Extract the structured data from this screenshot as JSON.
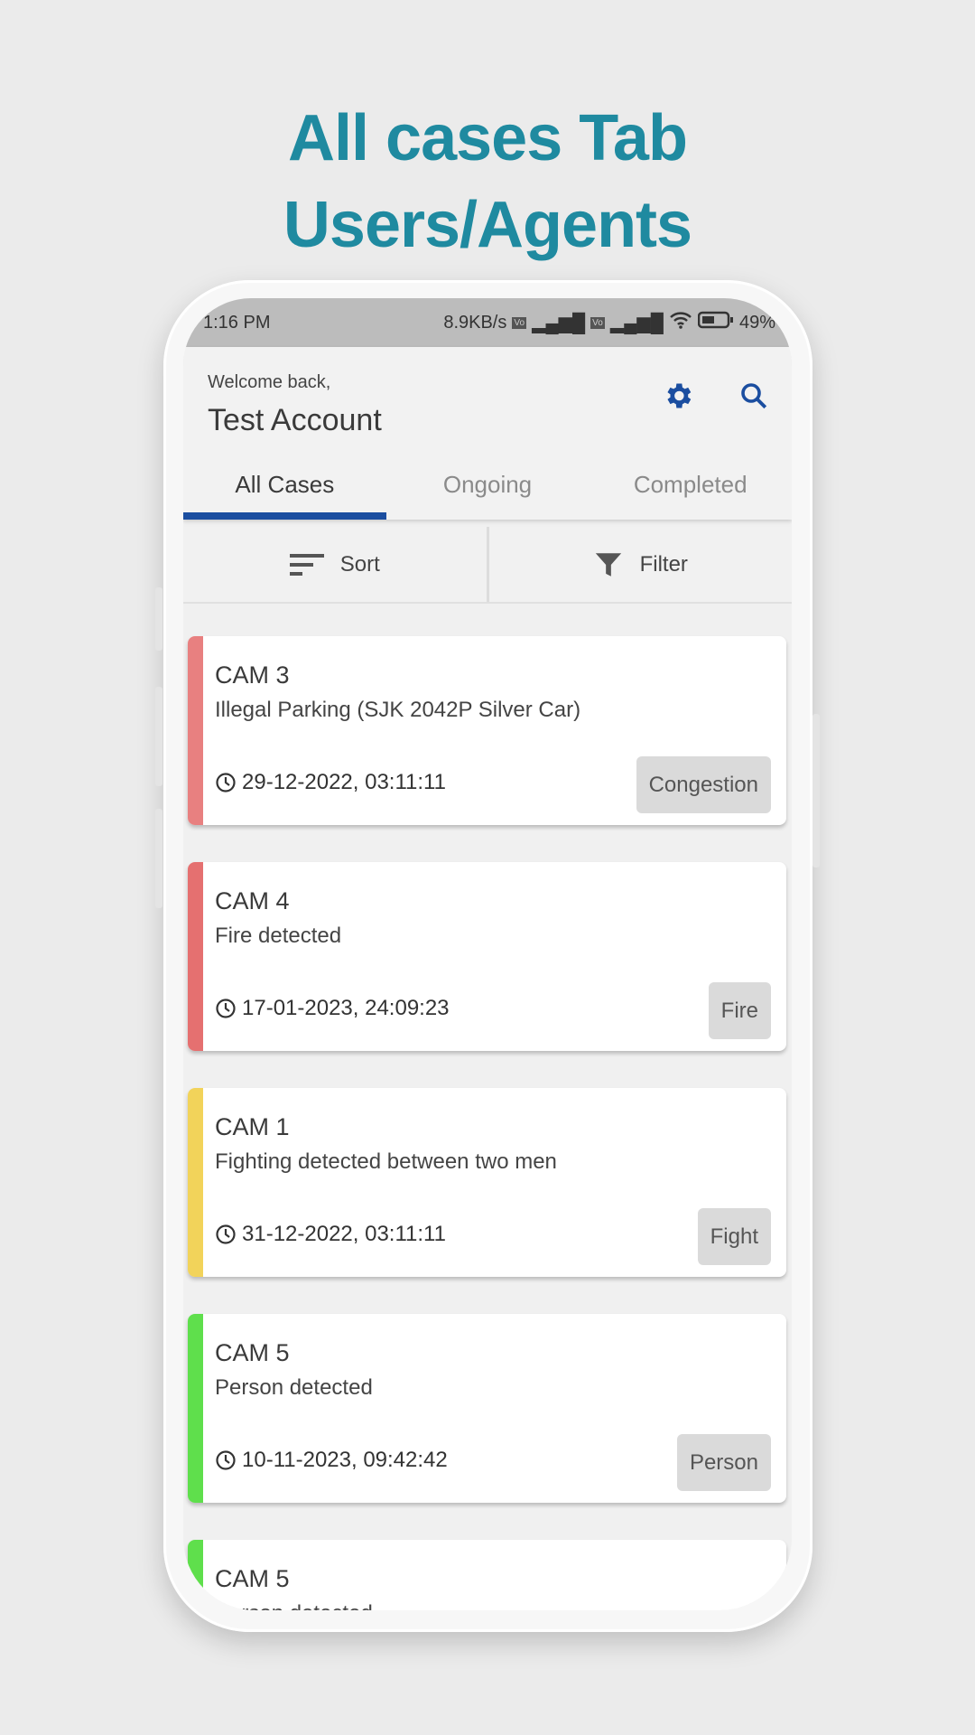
{
  "headline": {
    "line1": "All cases Tab",
    "line2": "Users/Agents"
  },
  "status_bar": {
    "time": "1:16 PM",
    "speed": "8.9KB/s",
    "battery": "49%"
  },
  "header": {
    "welcome": "Welcome back,",
    "account": "Test Account"
  },
  "tabs": [
    {
      "label": "All Cases",
      "active": true
    },
    {
      "label": "Ongoing"
    },
    {
      "label": "Completed"
    }
  ],
  "toolbar": {
    "sort_label": "Sort",
    "filter_label": "Filter"
  },
  "colors": {
    "accent": "#1b4ea0",
    "headline": "#1f8aa0",
    "red": "#e57373",
    "yellow": "#f2d35a",
    "green": "#5fdf4c"
  },
  "cases": [
    {
      "camera": "CAM 3",
      "description": "Illegal Parking (SJK 2042P Silver Car)",
      "datetime": "29-12-2022, 03:11:11",
      "tag": "Congestion",
      "color": "#e88080"
    },
    {
      "camera": "CAM 4",
      "description": "Fire detected",
      "datetime": "17-01-2023, 24:09:23",
      "tag": "Fire",
      "color": "#e57070"
    },
    {
      "camera": "CAM 1",
      "description": "Fighting detected between two men",
      "datetime": "31-12-2022, 03:11:11",
      "tag": "Fight",
      "color": "#f2d35a"
    },
    {
      "camera": "CAM 5",
      "description": "Person detected",
      "datetime": "10-11-2023, 09:42:42",
      "tag": "Person",
      "color": "#5fdf4c"
    },
    {
      "camera": "CAM 5",
      "description": "Person detected",
      "datetime": "",
      "tag": "",
      "color": "#5fdf4c"
    }
  ]
}
